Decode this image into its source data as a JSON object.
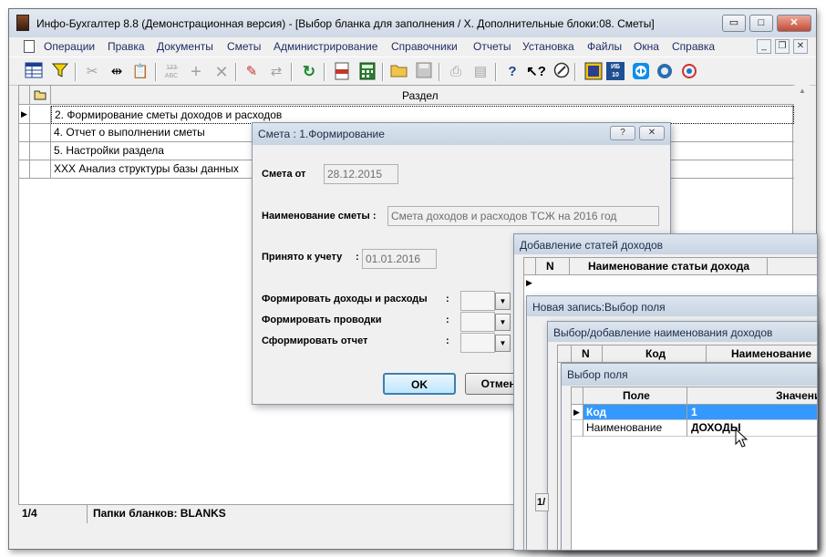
{
  "main_window": {
    "title": "Инфо-Бухгалтер 8.8 (Демонстрационная версия) - [Выбор бланка для заполнения / X. Дополнительные блоки:08. Сметы]",
    "controls": {
      "minimize": "▭",
      "maximize": "□",
      "close": "✕"
    },
    "mdi_controls": {
      "minimize": "_",
      "restore": "❐",
      "close": "✕"
    }
  },
  "menu": [
    "Операции",
    "Правка",
    "Документы",
    "Сметы",
    "Администрирование",
    "Справочники",
    "Отчеты",
    "Установка",
    "Файлы",
    "Окна",
    "Справка"
  ],
  "toolbar_icons": [
    "table-icon",
    "filter-icon",
    "cut-icon",
    "merge-icon",
    "paste-icon",
    "numbering-icon",
    "add-icon",
    "delete-icon",
    "marker-icon",
    "replace-icon",
    "refresh-icon",
    "pdf-icon",
    "calculator-icon",
    "open-folder-icon",
    "save-icon",
    "print-icon",
    "preview-icon",
    "help-icon",
    "context-help-icon",
    "compass-icon",
    "info-icon",
    "ib10-icon",
    "teamviewer-icon",
    "browser-icon",
    "network-icon"
  ],
  "toolbar_text": {
    "numbering": "1̶2̶3̶ ABC",
    "ib": "ИБ",
    "ib_num": "10"
  },
  "grid": {
    "header": "Раздел",
    "rows": [
      "2. Формирование сметы доходов и расходов",
      "4. Отчет о выполнении сметы",
      "5. Настройки раздела",
      "XXX Анализ структуры базы данных"
    ]
  },
  "status": {
    "position": "1/4",
    "folder": "Папки бланков: BLANKS"
  },
  "smeta_dialog": {
    "title": "Смета : 1.Формирование",
    "help_btn": "?",
    "close_btn": "✕",
    "date_label": "Смета от",
    "date_value": "28.12.2015",
    "name_label": "Наименование сметы :",
    "name_value": "Смета доходов и расходов ТСЖ на 2016 год",
    "accepted_label": "Принято к учету",
    "accepted_colon": ":",
    "accepted_value": "01.01.2016",
    "opt1_label": "Формировать доходы и расходы",
    "opt2_label": "Формировать проводки",
    "opt3_label": "Сформировать отчет",
    "colon": ":",
    "ok": "OK",
    "cancel": "Отмена"
  },
  "income_dialog": {
    "title": "Добавление статей доходов",
    "col_n": "N",
    "col_name": "Наименование статьи дохода"
  },
  "new_record_dialog": {
    "title": "Новая запись:Выбор поля"
  },
  "income_name_dialog": {
    "title": "Выбор/добавление наименования доходов",
    "col_n": "N",
    "col_code": "Код",
    "col_name": "Наименование",
    "footer": "1/"
  },
  "field_dialog": {
    "title": "Выбор поля",
    "col_field": "Поле",
    "col_value": "Значение",
    "rows": [
      {
        "field": "Код",
        "value": "1"
      },
      {
        "field": "Наименование",
        "value": "ДОХОДЫ"
      }
    ]
  }
}
